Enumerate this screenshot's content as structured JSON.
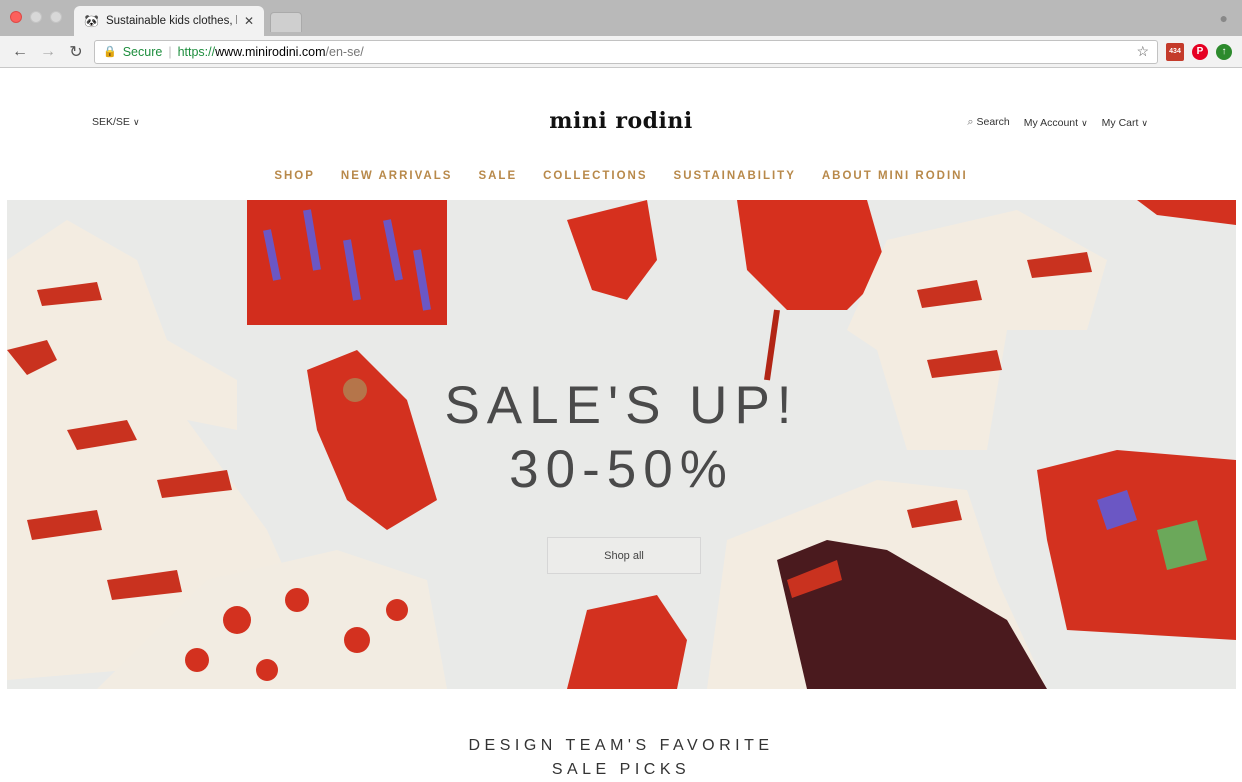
{
  "browser": {
    "tab_title": "Sustainable kids clothes, baby",
    "secure_label": "Secure",
    "url_scheme": "https://",
    "url_host": "www.minirodini.com",
    "url_path": "/en-se/",
    "extension_badge": "434"
  },
  "header": {
    "currency": "SEK/SE",
    "logo": "mini rodini",
    "search": "Search",
    "account": "My Account",
    "cart": "My Cart"
  },
  "nav": [
    "SHOP",
    "NEW ARRIVALS",
    "SALE",
    "COLLECTIONS",
    "SUSTAINABILITY",
    "ABOUT MINI RODINI"
  ],
  "hero": {
    "line1": "SALE'S UP!",
    "line2": "30-50%",
    "button": "Shop all"
  },
  "section": {
    "line1": "DESIGN TEAM'S FAVORITE",
    "line2": "SALE PICKS"
  },
  "colors": {
    "nav_gold": "#b8894a",
    "garment_red": "#d3311f",
    "hero_bg": "#e9eae8"
  }
}
